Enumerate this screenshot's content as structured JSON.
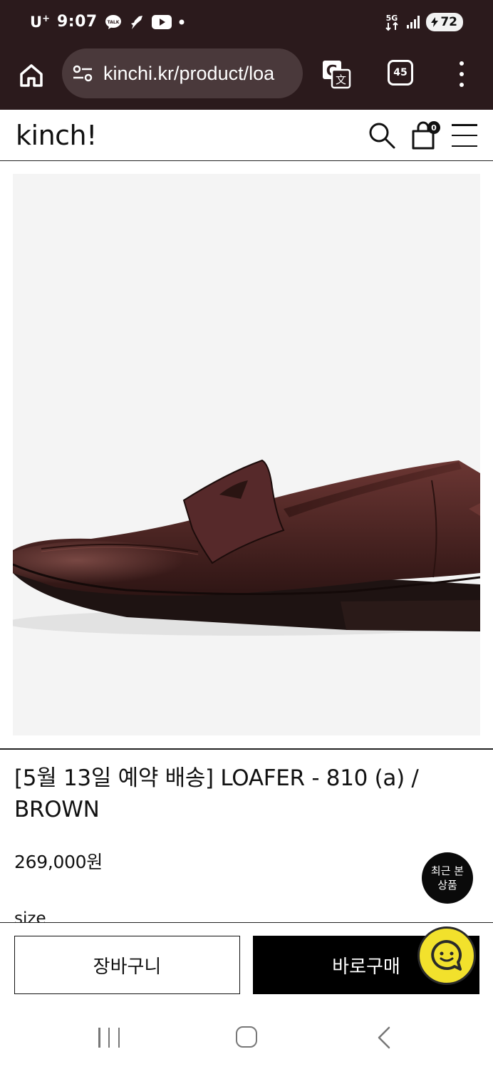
{
  "status_bar": {
    "carrier": "U",
    "carrier_sup": "+",
    "time": "9:07",
    "notification_icons": [
      "kakaotalk-icon",
      "app-icon",
      "youtube-icon",
      "dot-icon"
    ],
    "network": "5G",
    "battery": "72"
  },
  "browser": {
    "url": "kinchi.kr/product/loa",
    "tab_count": "45",
    "icons": [
      "home-icon",
      "site-settings-icon",
      "translate-icon",
      "tabs-icon",
      "more-icon"
    ]
  },
  "site_header": {
    "logo": "kinch!",
    "cart_count": "0",
    "icons": [
      "search-icon",
      "cart-icon",
      "hamburger-menu-icon"
    ]
  },
  "product": {
    "title": "[5월 13일 예약 배송] LOAFER - 810 (a) / BROWN",
    "price": "269,000원",
    "option_label": "size",
    "image_subject": "brown leather penny loafer"
  },
  "recent_viewed": {
    "line1": "최근 본",
    "line2": "상품"
  },
  "actions": {
    "cart_label": "장바구니",
    "buy_label": "바로구매"
  },
  "colors": {
    "browser_chrome": "#2b1a1c",
    "chat_button": "#f2e12c",
    "buy_button": "#000000",
    "shoe_leather": "#4a2422"
  }
}
